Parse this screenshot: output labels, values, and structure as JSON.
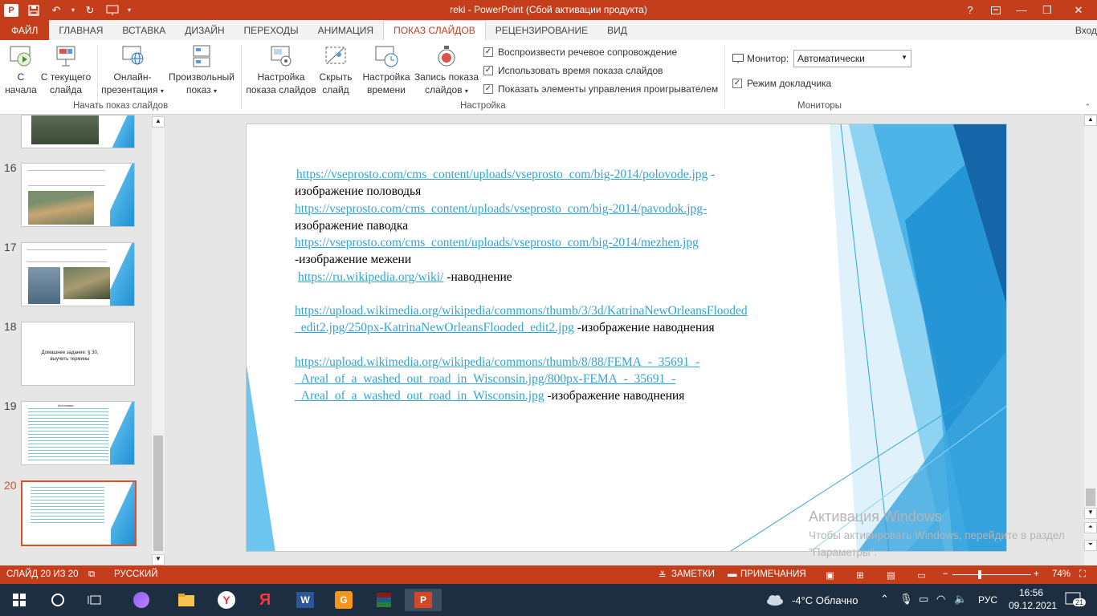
{
  "window": {
    "title": "reki - PowerPoint (Сбой активации продукта)",
    "controls": {
      "help": "?",
      "minimize": "—",
      "restore": "❐",
      "close": "✕"
    }
  },
  "tabs": [
    "ФАЙЛ",
    "ГЛАВНАЯ",
    "ВСТАВКА",
    "ДИЗАЙН",
    "ПЕРЕХОДЫ",
    "АНИМАЦИЯ",
    "ПОКАЗ СЛАЙДОВ",
    "РЕЦЕНЗИРОВАНИЕ",
    "ВИД"
  ],
  "signin": "Вход",
  "ribbon": {
    "from_start": [
      "С",
      "начала"
    ],
    "from_current": [
      "С текущего",
      "слайда"
    ],
    "online": [
      "Онлайн-",
      "презентация"
    ],
    "custom": [
      "Произвольный",
      "показ"
    ],
    "group_start": "Начать показ слайдов",
    "setup": [
      "Настройка",
      "показа слайдов"
    ],
    "hide": [
      "Скрыть",
      "слайд"
    ],
    "rehearse": [
      "Настройка",
      "времени"
    ],
    "record": [
      "Запись показа",
      "слайдов"
    ],
    "chk_narration": "Воспроизвести речевое сопровождение",
    "chk_timings": "Использовать время показа слайдов",
    "chk_controls": "Показать элементы управления проигрывателем",
    "group_setup": "Настройка",
    "monitor_label": "Монитор:",
    "monitor_value": "Автоматически",
    "presenter_view": "Режим докладчика",
    "group_monitors": "Мониторы"
  },
  "thumbnails": [
    {
      "num": "16",
      "text": "Запишите в тетради..."
    },
    {
      "num": "17",
      "text": "Наводнение..."
    },
    {
      "num": "18",
      "text": "Домашнее задание: § 30, выучить термины"
    },
    {
      "num": "19",
      "text": "Источники"
    },
    {
      "num": "20",
      "text": ""
    }
  ],
  "slide": {
    "l1_link": "https://vseprosto.com/cms_content/uploads/vseprosto_com/big-2014/polovode.jpg",
    "l1_dash": " -",
    "l1_text": "изображение половодья",
    "l2_link": "https://vseprosto.com/cms_content/uploads/vseprosto_com/big-2014/pavodok.jpg-",
    "l2_text": "изображение паводка",
    "l3_link": "https://vseprosto.com/cms_content/uploads/vseprosto_com/big-2014/mezhen.jpg",
    "l3_text": "-изображение межени",
    "l4_link": "https://ru.wikipedia.org/wiki/",
    "l4_text": " -наводнение",
    "l5_link_a": "https://upload.wikimedia.org/wikipedia/commons/thumb/3/3d/KatrinaNewOrleansFlooded",
    "l5_link_b": "_edit2.jpg/250px-KatrinaNewOrleansFlooded_edit2.jpg",
    "l5_text": " -изображение наводнения",
    "l6_link_a": "https://upload.wikimedia.org/wikipedia/commons/thumb/8/88/FEMA_-_35691_-",
    "l6_link_b": "_Areal_of_a_washed_out_road_in_Wisconsin.jpg/800px-FEMA_-_35691_-",
    "l6_link_c": "_Areal_of_a_washed_out_road_in_Wisconsin.jpg",
    "l6_text": " -изображение наводнения"
  },
  "watermark": {
    "title": "Активация Windows",
    "body": "Чтобы активировать Windows, перейдите в раздел \"Параметры\"."
  },
  "status": {
    "slide_of": "СЛАЙД 20 ИЗ 20",
    "language": "РУССКИЙ",
    "notes": "ЗАМЕТКИ",
    "comments": "ПРИМЕЧАНИЯ",
    "zoom": "74%"
  },
  "taskbar": {
    "weather": "-4°C  Облачно",
    "lang": "РУС",
    "time": "16:56",
    "date": "09.12.2021",
    "notifications": "21"
  },
  "colors": {
    "accent": "#c43e1c",
    "link": "#2fa5d6",
    "slide_blue": "#1e8fd2"
  }
}
